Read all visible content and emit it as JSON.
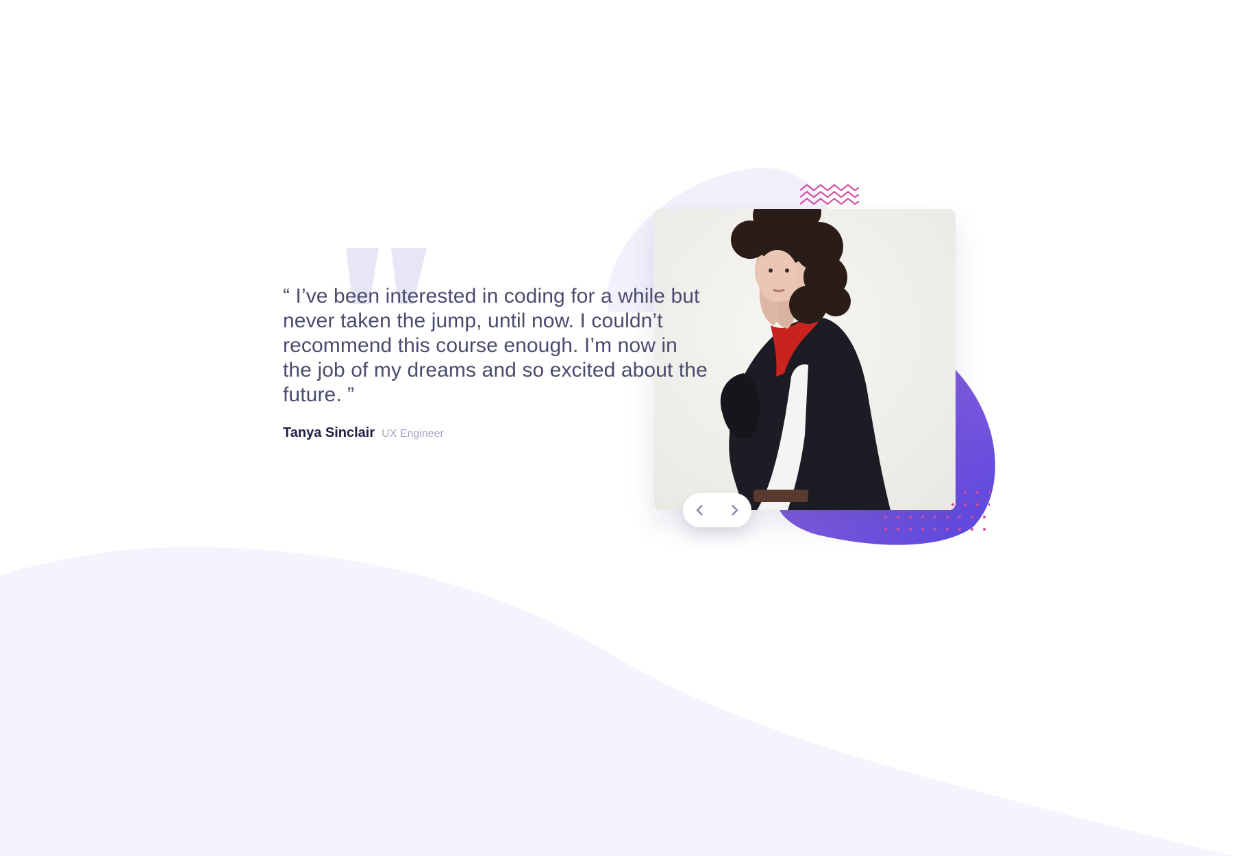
{
  "testimonial": {
    "quote": "“ I’ve been interested in coding for a while but never taken the jump, until now. I couldn’t recommend this course enough. I’m now in the job of my dreams and so excited about the future. ”",
    "author_name": "Tanya Sinclair",
    "author_role": "UX Engineer"
  },
  "photo": {
    "alt": "Portrait of Tanya Sinclair"
  },
  "navigation": {
    "prev_icon": "chevron-left-icon",
    "next_icon": "chevron-right-icon"
  },
  "colors": {
    "background": "#ffffff",
    "wave": "#f3f4fc",
    "quote_text": "#4a4b6e",
    "author_name": "#202046",
    "author_role": "#a2a3be",
    "purple_blob_start": "#9a6ad8",
    "purple_blob_end": "#5a46e0",
    "decoration_pink": "#d24fa0",
    "quote_mark": "#e7e6f7"
  }
}
